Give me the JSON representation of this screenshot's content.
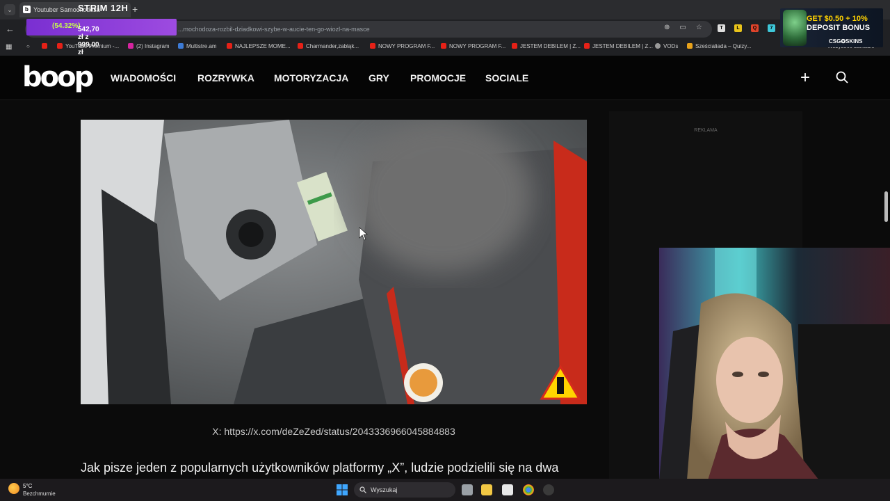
{
  "browser": {
    "tab_title": "Youtuber Samochodoza",
    "overlay_title": "STRIM 12H",
    "url": "...mochodoza-rozbil-dziadkowi-szybe-w-aucie-ten-go-wiozl-na-masce",
    "bookmarks": [
      "YouTube Premium -...",
      "(2) Instagram",
      "Multistre.am",
      "NAJLEPSZE MOME...",
      "Charmander,zabląk...",
      "NOWY PROGRAM F...",
      "NOWY PROGRAM F...",
      "JESTEM DEBILEM | Z...",
      "JESTEM DEBILEM | Z...",
      "VODs",
      "Sześcialiada – Quizy..."
    ],
    "bookmarks_all": "Wszystkie zakładki"
  },
  "donation_goal": {
    "amount": "542,70 zł z 999,00 zł",
    "percent": "(54.32%)"
  },
  "ad_banner": {
    "line1": "GET $0.50 + 10%",
    "line2": "DEPOSIT BONUS",
    "brand": "CSG✪SKINS"
  },
  "site": {
    "logo": "boop",
    "nav": [
      "WIADOMOŚCI",
      "ROZRYWKA",
      "MOTORYZACJA",
      "GRY",
      "PROMOCJE",
      "SOCIALE"
    ],
    "ad_label": "REKLAMA"
  },
  "article": {
    "caption": "X: https://x.com/deZeZed/status/2043336966045884883",
    "paragraph": "Jak pisze jeden z popularnych użytkowników platformy „X”, ludzie podzielili się na dwa"
  },
  "taskbar": {
    "temperature": "5°C",
    "weather": "Bezchmurnie",
    "search_placeholder": "Wyszukaj"
  },
  "colors": {
    "accent_purple": "#8a3bd8",
    "goal_percent": "#c6ff4a",
    "site_bg": "#050505"
  }
}
